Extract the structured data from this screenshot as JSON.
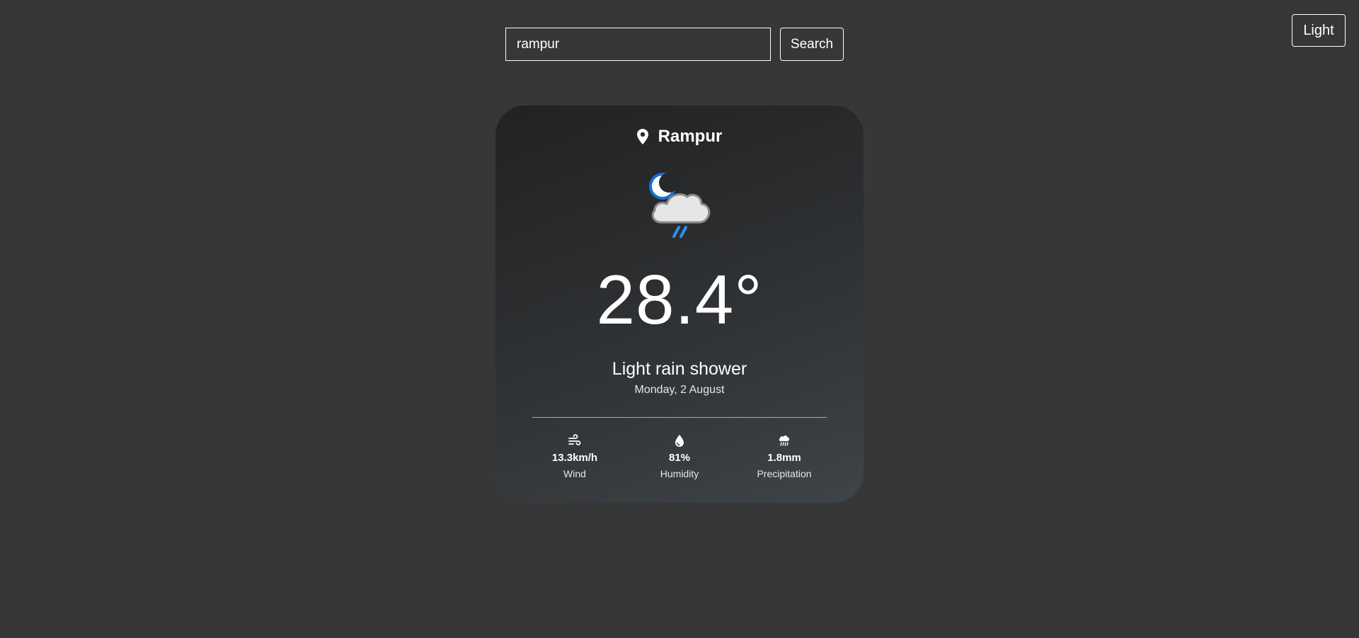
{
  "theme_toggle": {
    "label": "Light"
  },
  "search": {
    "value": "rampur",
    "button_label": "Search"
  },
  "weather": {
    "location": "Rampur",
    "icon": "night-cloud-rain-icon",
    "temperature": "28.4°",
    "condition": "Light rain shower",
    "date": "Monday, 2 August",
    "stats": {
      "wind": {
        "value": "13.3km/h",
        "label": "Wind",
        "icon": "wind-icon"
      },
      "humidity": {
        "value": "81%",
        "label": "Humidity",
        "icon": "water-drop-icon"
      },
      "precipitation": {
        "value": "1.8mm",
        "label": "Precipitation",
        "icon": "cloud-rain-icon"
      }
    }
  },
  "colors": {
    "background": "#373737",
    "card_gradient_start": "#212223",
    "card_gradient_end": "#3f4448",
    "moon": "#1a6fd6",
    "rain": "#2e8ef0"
  }
}
